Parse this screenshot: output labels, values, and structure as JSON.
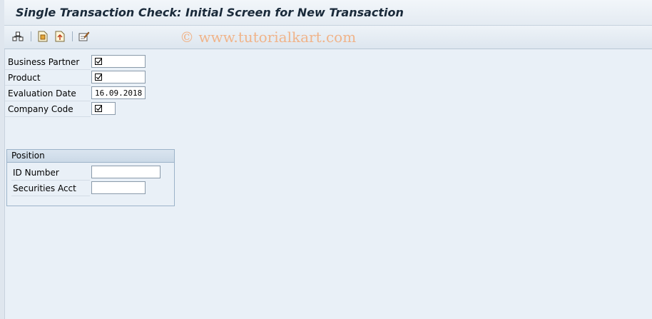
{
  "title": "Single Transaction Check: Initial Screen for New Transaction",
  "watermark": "© www.tutorialkart.com",
  "toolbar": {
    "icons": [
      "execute-icon",
      "save-variant-icon",
      "get-variant-icon",
      "edit-icon"
    ]
  },
  "fields": {
    "business_partner": {
      "label": "Business Partner",
      "value": ""
    },
    "product": {
      "label": "Product",
      "value": ""
    },
    "evaluation_date": {
      "label": "Evaluation Date",
      "value": "16.09.2018"
    },
    "company_code": {
      "label": "Company Code",
      "value": ""
    }
  },
  "position_group": {
    "title": "Position",
    "id_number": {
      "label": "ID Number",
      "value": ""
    },
    "securities_acct": {
      "label": "Securities Acct",
      "value": ""
    }
  },
  "colors": {
    "background": "#e9f0f7",
    "watermark": "#f0b48a",
    "title": "#1a2a3a"
  }
}
